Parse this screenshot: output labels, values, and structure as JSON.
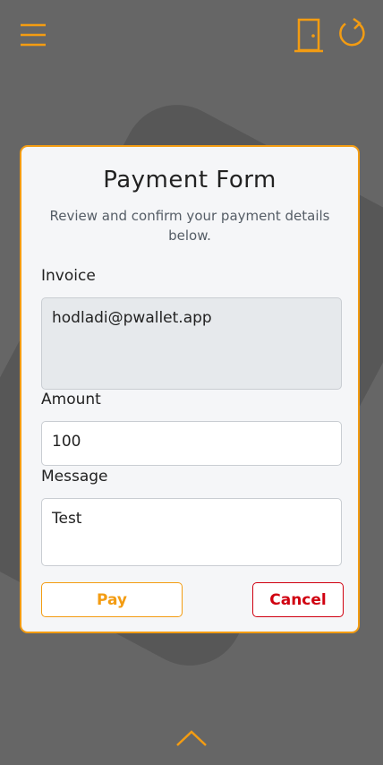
{
  "colors": {
    "accent": "#f39c12",
    "danger": "#d00010",
    "background": "#666666"
  },
  "header": {
    "icons": [
      "menu-icon",
      "door-exit-icon",
      "refresh-icon"
    ]
  },
  "form": {
    "title": "Payment Form",
    "subtitle": "Review and confirm your payment details below.",
    "invoice": {
      "label": "Invoice",
      "value": "hodladi@pwallet.app"
    },
    "amount": {
      "label": "Amount",
      "value": "100"
    },
    "message": {
      "label": "Message",
      "value": "Test"
    },
    "pay_label": "Pay",
    "cancel_label": "Cancel"
  },
  "footer": {
    "icon": "chevron-up-icon"
  }
}
